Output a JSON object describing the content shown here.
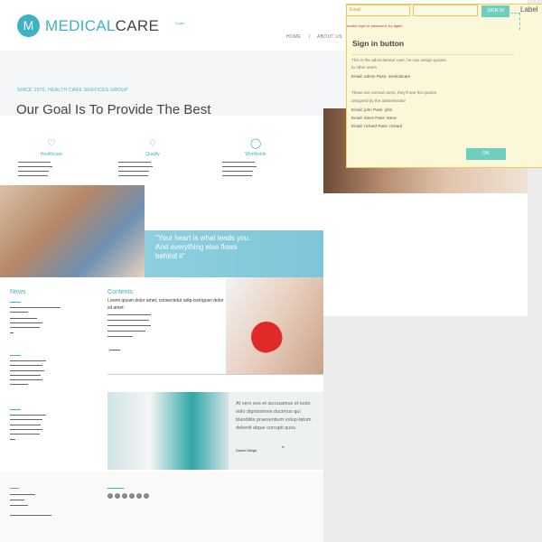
{
  "header": {
    "logo_letter": "M",
    "logo_part1": "MEDICAL",
    "logo_part2": "CARE",
    "top_link": "Login",
    "nav": [
      "HOME",
      "/",
      "ABOUT US"
    ]
  },
  "hero": {
    "tagline": "SINCE 1970, HEALTH CARE SERVICES GROUP",
    "headline": "Our Goal Is To Provide The Best"
  },
  "features": [
    {
      "icon": "heart-icon",
      "label": "Healthcare"
    },
    {
      "icon": "diamond-icon",
      "label": "Quality"
    },
    {
      "icon": "globe-icon",
      "label": "Worldwide"
    }
  ],
  "quote": "\"Your heart is what leads you. And everything else flows behind it\"",
  "sections": {
    "news_title": "News",
    "contents_title": "Contents",
    "contents_text": "Lorem ipsum dolor amet, consectetur adip-iscingusn dolor sit amet:",
    "nurse_quote": "At vero eos et accusamus et iusto odio dignissimos ducimus qui blanditiis praesentium volup-tatum deleniti atque corrupti quos.",
    "nurse_author": "Daniel Melge",
    "quote_mark": "”"
  },
  "login_panel": {
    "email_placeholder": "Email",
    "password_placeholder": "",
    "signin_label": "SIGN IN",
    "label_text": "Label",
    "error_text": "invalid login or password, try again",
    "title": "Sign in button",
    "admin_desc_1": "This is the administrator user, he can assign quotes",
    "admin_desc_2": "to other users",
    "admin_cred": "Email: admin      Pass: medicalcare",
    "users_desc_1": "These are normal users, they'll see the quotes",
    "users_desc_2": "assigned by the administrator",
    "user1": "Email: john          Pass: john",
    "user2": "Email: steve         Pass: steve",
    "user3": "Email: richard      Pass: richard",
    "ok_label": "OK"
  },
  "colors": {
    "accent": "#3bb3c3",
    "button": "#6fcfbf",
    "panel_bg": "#fbf7d9",
    "panel_border": "#f0cc55"
  }
}
